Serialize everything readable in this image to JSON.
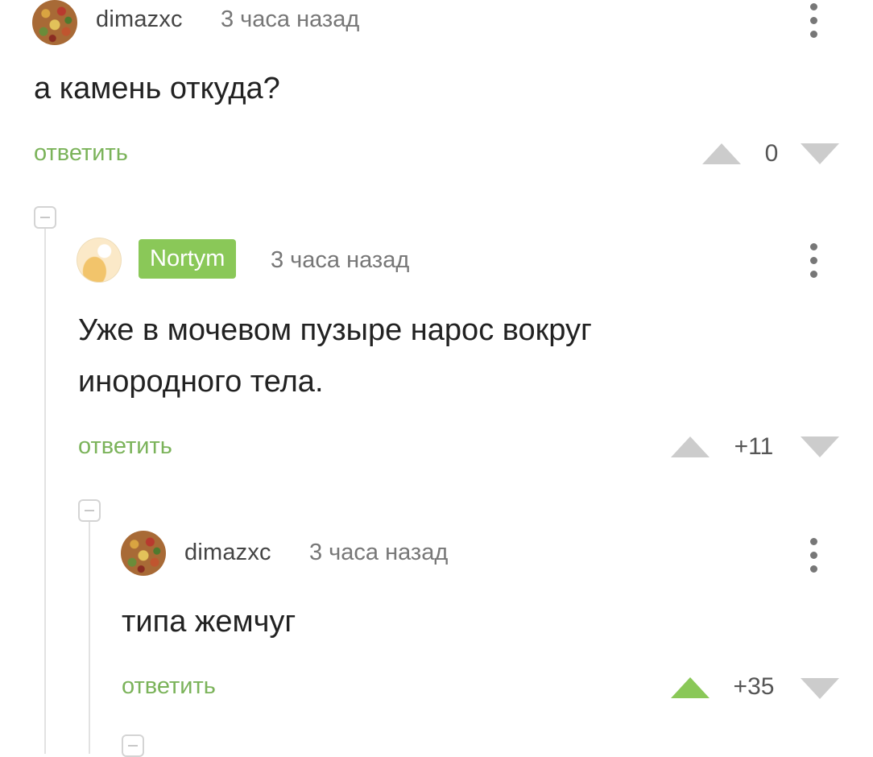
{
  "comments": [
    {
      "author": "dimazxc",
      "time": "3 часа назад",
      "text": "а камень откуда?",
      "reply_label": "ответить",
      "score": "0",
      "avatar_icon": "mosaic-avatar"
    },
    {
      "author": "Nortym",
      "author_badge_color": "#8ac858",
      "time": "3 часа назад",
      "text": "Уже в мочевом пузыре нарос вокруг инородного тела.",
      "reply_label": "ответить",
      "score": "+11",
      "avatar_icon": "chef-avatar"
    },
    {
      "author": "dimazxc",
      "time": "3 часа назад",
      "text": "типа жемчуг",
      "reply_label": "ответить",
      "score": "+35",
      "upvoted": true,
      "avatar_icon": "mosaic-avatar"
    }
  ],
  "colors": {
    "accent_green": "#7bb35a",
    "vote_active": "#8ac858",
    "vote_inactive": "#cccccc"
  }
}
